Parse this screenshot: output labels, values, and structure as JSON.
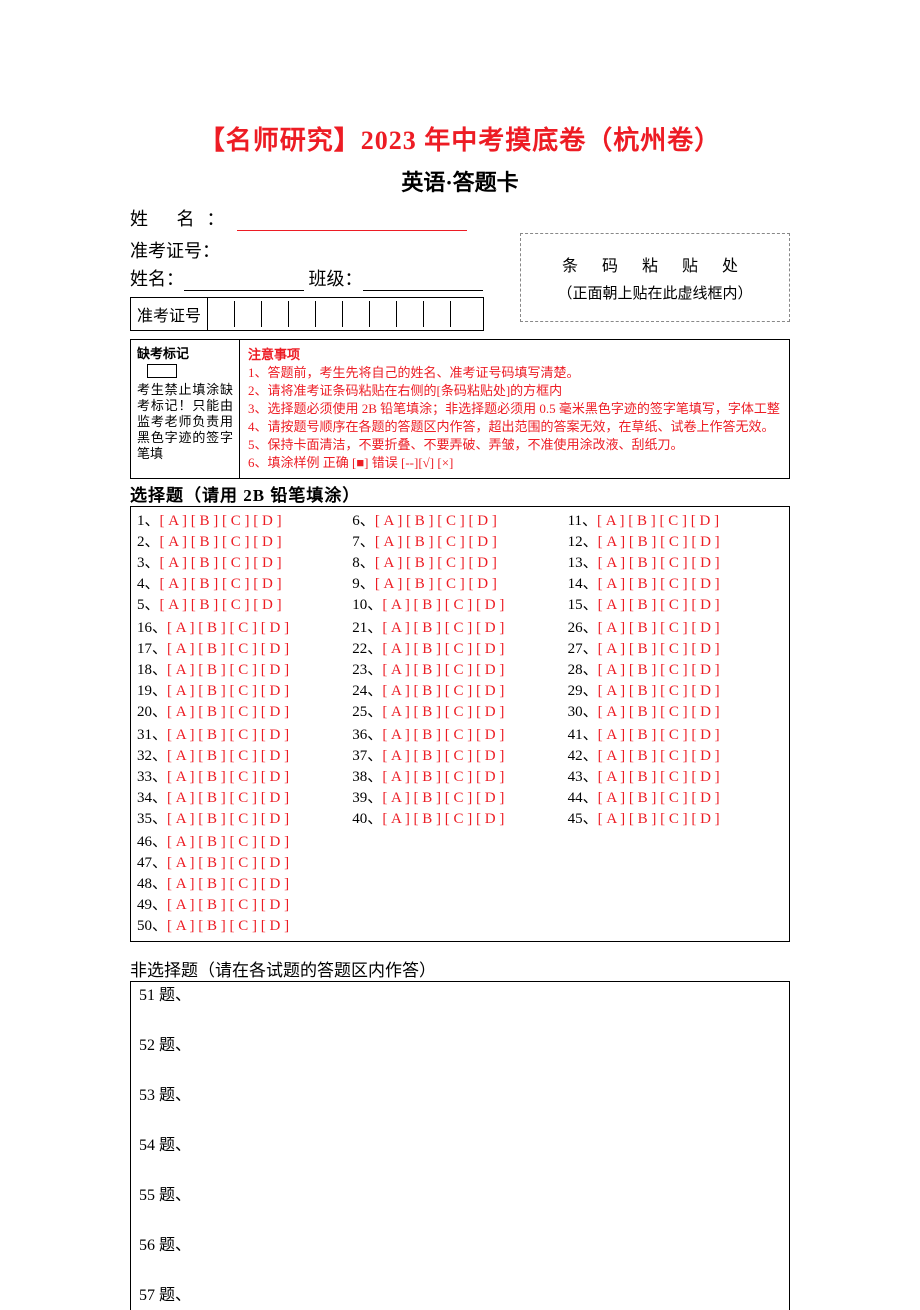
{
  "header": {
    "title": "【名师研究】2023 年中考摸底卷（杭州卷）",
    "subtitle": "英语·答题卡"
  },
  "fields": {
    "name_label": "姓    名：",
    "reg_label": "准考证号：",
    "name2_label": "姓名：",
    "class_label": "班级：",
    "zk_label": "准考证号"
  },
  "barcode": {
    "title": "条  码  粘  贴  处",
    "sub": "（正面朝上贴在此虚线框内）"
  },
  "absent": {
    "header": "缺考标记",
    "body": "考生禁止填涂缺考标记！只能由监考老师负责用黑色字迹的签字笔填"
  },
  "notice": {
    "header": "注意事项",
    "items": [
      "1、答题前，考生先将自己的姓名、准考证号码填写清楚。",
      "2、请将准考证条码粘贴在右侧的[条码粘贴处]的方框内",
      "3、选择题必须使用 2B 铅笔填涂；非选择题必须用 0.5 毫米黑色字迹的签字笔填写，字体工整",
      "4、请按题号顺序在各题的答题区内作答，超出范围的答案无效，在草纸、试卷上作答无效。",
      "5、保持卡面清洁，不要折叠、不要弄破、弄皱，不准使用涂改液、刮纸刀。",
      "6、填涂样例   正确 [■]  错误 [--][√] [×]"
    ]
  },
  "mc": {
    "header": "选择题（请用 2B 铅笔填涂）",
    "pattern": "[ A ] [ B ] [ C ] [ D ]",
    "groups": [
      [
        [
          1,
          2,
          3,
          4,
          5
        ],
        [
          6,
          7,
          8,
          9,
          10
        ],
        [
          11,
          12,
          13,
          14,
          15
        ]
      ],
      [
        [
          16,
          17,
          18,
          19,
          20
        ],
        [
          21,
          22,
          23,
          24,
          25
        ],
        [
          26,
          27,
          28,
          29,
          30
        ]
      ],
      [
        [
          31,
          32,
          33,
          34,
          35
        ],
        [
          36,
          37,
          38,
          39,
          40
        ],
        [
          41,
          42,
          43,
          44,
          45
        ]
      ],
      [
        [
          46,
          47,
          48,
          49,
          50
        ],
        [],
        []
      ]
    ]
  },
  "nonmc": {
    "header": "非选择题（请在各试题的答题区内作答）",
    "suffix": " 题、",
    "numbers": [
      51,
      52,
      53,
      54,
      55,
      56,
      57
    ]
  }
}
